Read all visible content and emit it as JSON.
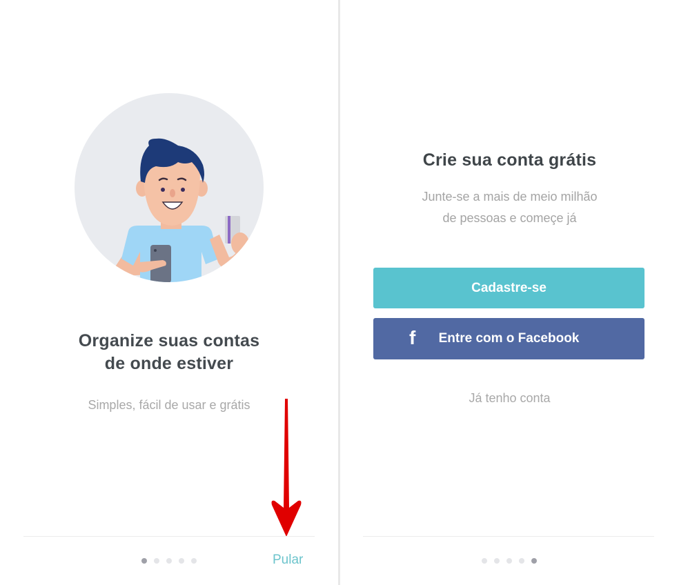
{
  "left_screen": {
    "illustration": "man-holding-phone-and-credit-card-illustration",
    "headline_lines": [
      "Organize suas contas",
      "de onde estiver"
    ],
    "subtext": "Simples, fácil de usar e grátis",
    "skip_label": "Pular",
    "page_indicator": {
      "total": 5,
      "active_index": 0
    },
    "annotation": "red-down-arrow pointing to Pular"
  },
  "right_screen": {
    "title": "Crie sua conta grátis",
    "subtext_lines": [
      "Junte-se a mais de meio milhão",
      "de pessoas e começe já"
    ],
    "signup_button_label": "Cadastre-se",
    "facebook_button_label": "Entre com o Facebook",
    "facebook_icon": "f",
    "login_link_label": "Já tenho conta",
    "page_indicator": {
      "total": 5,
      "active_index": 4
    }
  },
  "colors": {
    "signup_button": "#59c3cf",
    "facebook_button": "#5169a3",
    "skip_link": "#6cc4cc",
    "annotation_arrow": "#e00000",
    "headline_text": "#444a4f",
    "muted_text": "#a8a8a8"
  }
}
